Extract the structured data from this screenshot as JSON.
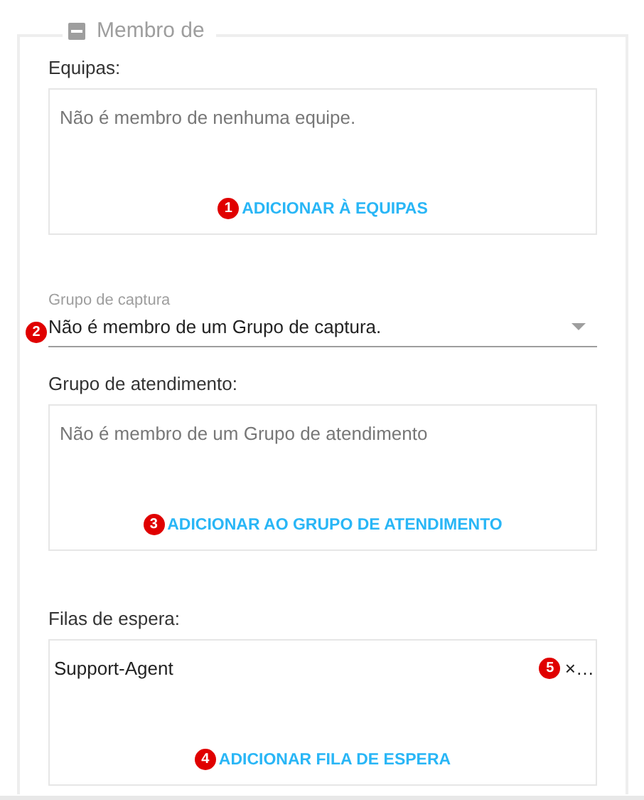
{
  "section": {
    "title": "Membro de",
    "expanded": true
  },
  "fields": [
    {
      "kind": "list",
      "label": "Equipas:",
      "empty_text": "Não é membro de nenhuma equipe.",
      "action": {
        "marker": "1",
        "label": "ADICIONAR À EQUIPAS"
      }
    },
    {
      "kind": "select",
      "label": "Grupo de captura",
      "marker": "2",
      "value": "Não é membro de um Grupo de captura."
    },
    {
      "kind": "list",
      "label": "Grupo de atendimento:",
      "empty_text": "Não é membro de um Grupo de atendimento",
      "action": {
        "marker": "3",
        "label": "ADICIONAR AO GRUPO DE ATENDIMENTO"
      }
    },
    {
      "kind": "list",
      "label": "Filas de espera:",
      "items": [
        {
          "name": "Support-Agent",
          "marker": "5",
          "remove": "×…"
        }
      ],
      "action": {
        "marker": "4",
        "label": "ADICIONAR FILA DE ESPERA"
      }
    }
  ]
}
